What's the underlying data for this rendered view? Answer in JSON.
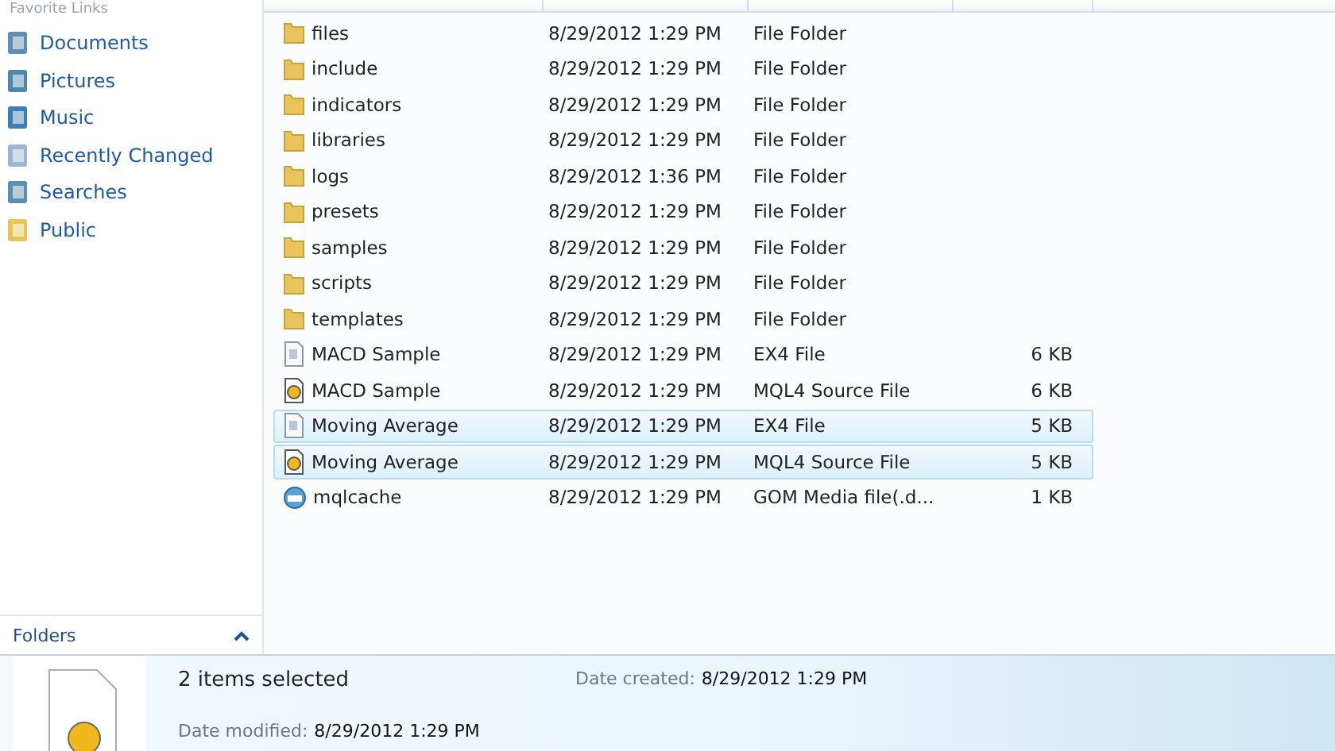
{
  "sidebar": {
    "heading": "Favorite Links",
    "items": [
      {
        "label": "Documents",
        "kind": "documents"
      },
      {
        "label": "Pictures",
        "kind": "pictures"
      },
      {
        "label": "Music",
        "kind": "music"
      },
      {
        "label": "Recently Changed",
        "kind": "recent"
      },
      {
        "label": "Searches",
        "kind": "searches"
      },
      {
        "label": "Public",
        "kind": "folder"
      }
    ],
    "folders_bar": {
      "label": "Folders",
      "expanded": true
    }
  },
  "file_list": {
    "rows": [
      {
        "name": "files",
        "date": "8/29/2012 1:29 PM",
        "type": "File Folder",
        "kind": "folder",
        "selected": false
      },
      {
        "name": "include",
        "date": "8/29/2012 1:29 PM",
        "type": "File Folder",
        "kind": "folder",
        "selected": false
      },
      {
        "name": "indicators",
        "date": "8/29/2012 1:29 PM",
        "type": "File Folder",
        "kind": "folder",
        "selected": false
      },
      {
        "name": "libraries",
        "date": "8/29/2012 1:29 PM",
        "type": "File Folder",
        "kind": "folder",
        "selected": false
      },
      {
        "name": "logs",
        "date": "8/29/2012 1:36 PM",
        "type": "File Folder",
        "kind": "folder",
        "selected": false
      },
      {
        "name": "presets",
        "date": "8/29/2012 1:29 PM",
        "type": "File Folder",
        "kind": "folder",
        "selected": false
      },
      {
        "name": "samples",
        "date": "8/29/2012 1:29 PM",
        "type": "File Folder",
        "kind": "folder",
        "selected": false
      },
      {
        "name": "scripts",
        "date": "8/29/2012 1:29 PM",
        "type": "File Folder",
        "kind": "folder",
        "selected": false
      },
      {
        "name": "templates",
        "date": "8/29/2012 1:29 PM",
        "type": "File Folder",
        "kind": "folder",
        "selected": false
      },
      {
        "name": "MACD Sample",
        "date": "8/29/2012 1:29 PM",
        "type": "EX4 File",
        "size": "6 KB",
        "kind": "document",
        "selected": false
      },
      {
        "name": "MACD Sample",
        "date": "8/29/2012 1:29 PM",
        "type": "MQL4 Source File",
        "size": "6 KB",
        "kind": "source",
        "selected": false
      },
      {
        "name": "Moving Average",
        "date": "8/29/2012 1:29 PM",
        "type": "EX4 File",
        "size": "5 KB",
        "kind": "document",
        "selected": true
      },
      {
        "name": "Moving Average",
        "date": "8/29/2012 1:29 PM",
        "type": "MQL4 Source File",
        "size": "5 KB",
        "kind": "source",
        "selected": true
      },
      {
        "name": "mqlcache",
        "date": "8/29/2012 1:29 PM",
        "type": "GOM Media file(.d...",
        "size": "1 KB",
        "kind": "media",
        "selected": false
      }
    ]
  },
  "details": {
    "summary": "2 items selected",
    "created_label": "Date created:",
    "created": "8/29/2012 1:29 PM",
    "modified_label": "Date modified:",
    "modified": "8/29/2012 1:29 PM"
  }
}
